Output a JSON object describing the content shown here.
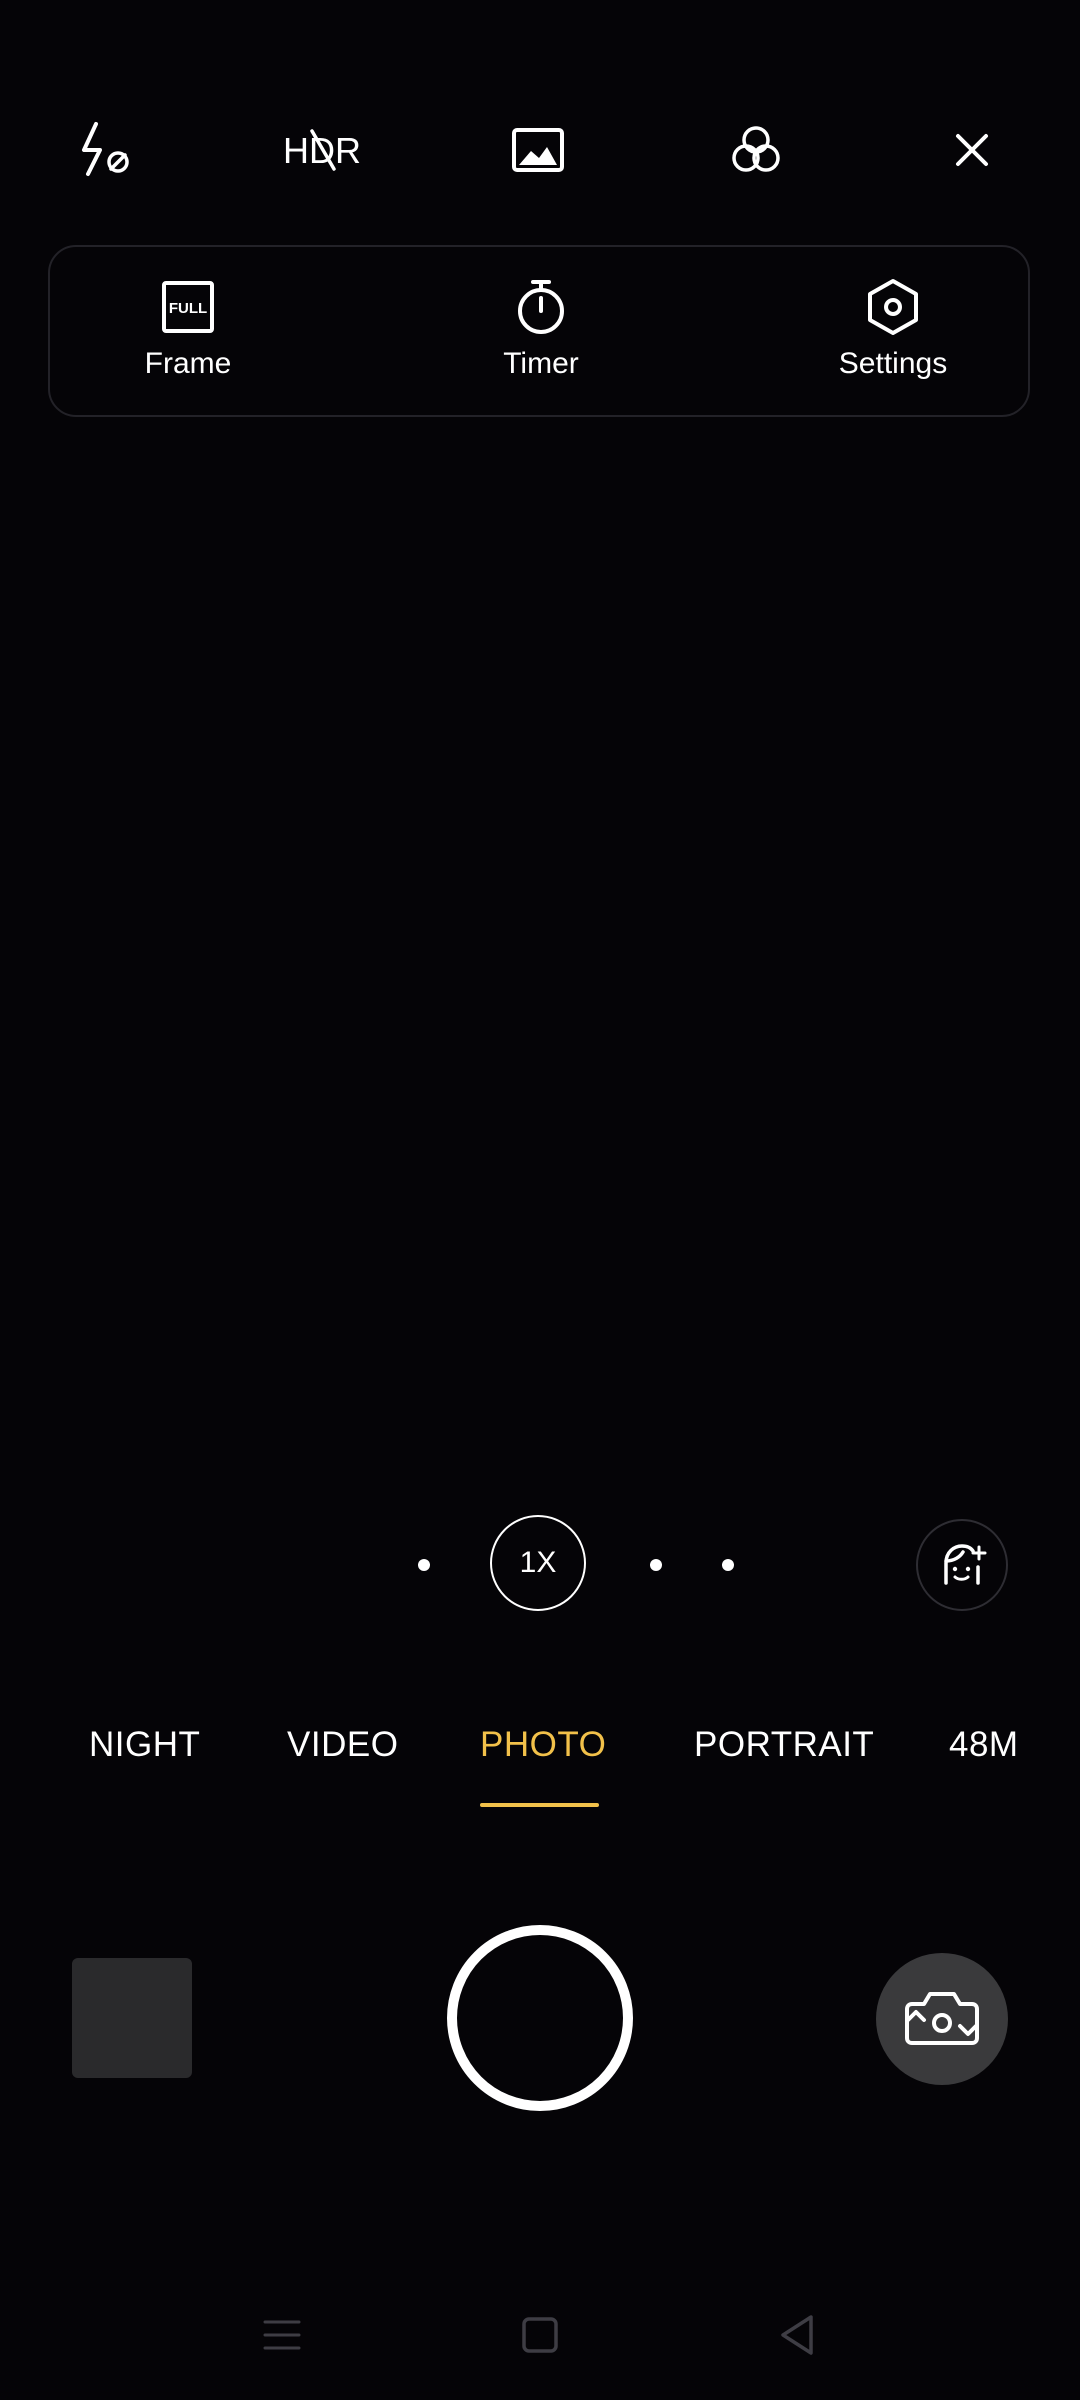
{
  "top_toolbar": {
    "flash_icon": "flash-off-icon",
    "hdr_label": "HDR",
    "hdr_icon": "hdr-off-icon",
    "aspect_icon": "image-icon",
    "filter_icon": "filter-circles-icon",
    "close_icon": "close-icon"
  },
  "quick_panel": {
    "frame": {
      "label": "Frame",
      "badge": "FULL",
      "icon": "frame-full-icon"
    },
    "timer": {
      "label": "Timer",
      "icon": "stopwatch-icon"
    },
    "settings": {
      "label": "Settings",
      "icon": "hexagon-gear-icon"
    }
  },
  "zoom": {
    "current": "1X"
  },
  "beauty": {
    "icon": "beauty-face-icon"
  },
  "modes": {
    "items": [
      "NIGHT",
      "VIDEO",
      "PHOTO",
      "PORTRAIT",
      "48M"
    ],
    "active": "PHOTO"
  },
  "capture": {
    "gallery_icon": "gallery-thumbnail",
    "shutter_icon": "shutter-button",
    "switch_icon": "switch-camera-icon"
  },
  "nav_bar": {
    "menu_icon": "menu-icon",
    "home_icon": "home-icon",
    "back_icon": "back-icon"
  },
  "colors": {
    "background": "#050407",
    "accent": "#f2c14a",
    "panel_border": "#232228",
    "thumb": "#2a2a2c",
    "switch_bg": "#3a3a3c",
    "nav": "#3e3d44"
  }
}
